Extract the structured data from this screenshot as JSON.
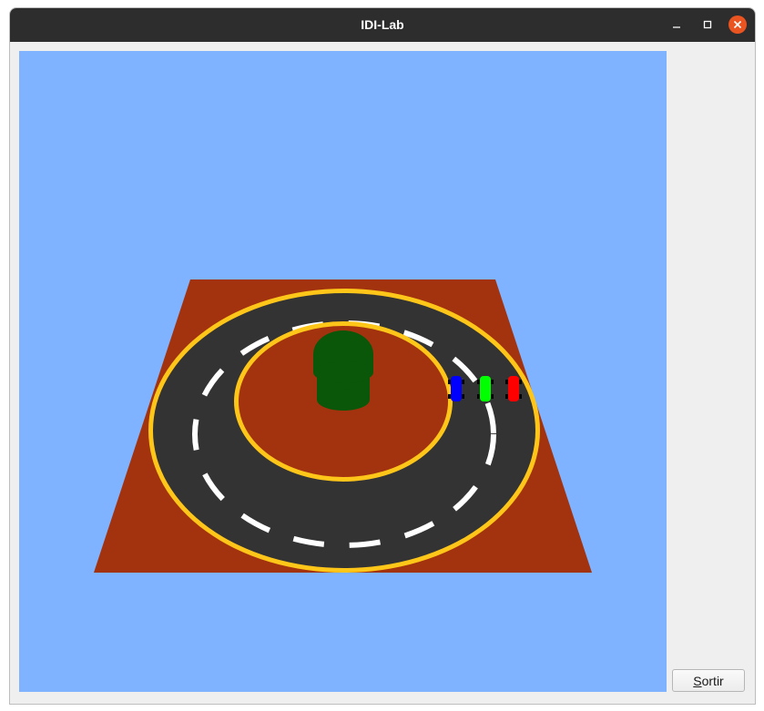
{
  "window": {
    "title": "IDI-Lab",
    "controls": {
      "minimize_icon": "minimize-icon",
      "maximize_icon": "maximize-icon",
      "close_icon": "close-icon"
    }
  },
  "viewport": {
    "background_color": "#7fb2ff",
    "scene": {
      "ground_color": "#a3330e",
      "track_color": "#333333",
      "track_border_color": "#ffc61a",
      "lane_marking_color": "#ffffff",
      "tree_color": "#0a5709",
      "cars": [
        {
          "name": "blue-car",
          "color": "#0000ff"
        },
        {
          "name": "green-car",
          "color": "#00ff00"
        },
        {
          "name": "red-car",
          "color": "#ff0000"
        }
      ]
    }
  },
  "buttons": {
    "sortir": {
      "mnemonic": "S",
      "rest": "ortir"
    }
  }
}
